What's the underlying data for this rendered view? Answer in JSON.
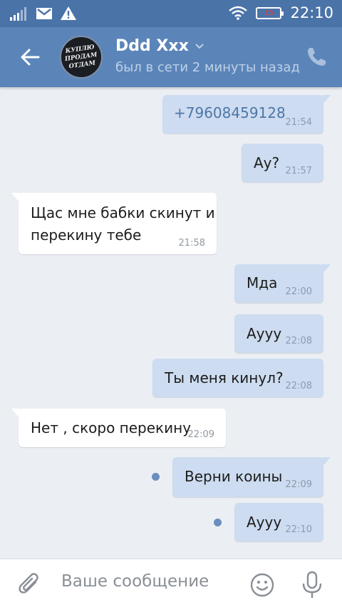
{
  "status_bar": {
    "time": "22:10",
    "battery_level": "15",
    "icons": [
      "signal-icon",
      "mail-icon",
      "warning-icon",
      "wifi-icon",
      "battery-icon"
    ]
  },
  "header": {
    "contact_name": "Ddd Xxx",
    "contact_status": "был в сети 2 минуты назад",
    "avatar_text": "КУПЛЮ\nПРОДАМ\nОТДАМ"
  },
  "messages": [
    {
      "direction": "out",
      "text": "+79608459128",
      "time": "21:54"
    },
    {
      "direction": "out",
      "text": "Ау?",
      "time": "21:57"
    },
    {
      "direction": "in",
      "text": "Щас мне бабки скинут и\nперекину тебе",
      "time": "21:58"
    },
    {
      "direction": "out",
      "text": "Мда",
      "time": "22:00"
    },
    {
      "direction": "out",
      "text": "Аууу",
      "time": "22:08"
    },
    {
      "direction": "out",
      "text": "Ты меня кинул?",
      "time": "22:08"
    },
    {
      "direction": "in",
      "text": "Нет , скоро перекину",
      "time": "22:09"
    },
    {
      "direction": "out",
      "text": "Верни коины",
      "time": "22:09",
      "unread": true
    },
    {
      "direction": "out",
      "text": "Аууу",
      "time": "22:10",
      "unread": true
    }
  ],
  "composer": {
    "placeholder": "Ваше сообщение"
  },
  "colors": {
    "status_bar": "#4a73a8",
    "header": "#5b85b9",
    "chat_background": "#ebeff4",
    "outgoing_bubble": "#cddcf0",
    "incoming_bubble": "#ffffff",
    "unread_dot": "#6a8fbe"
  }
}
